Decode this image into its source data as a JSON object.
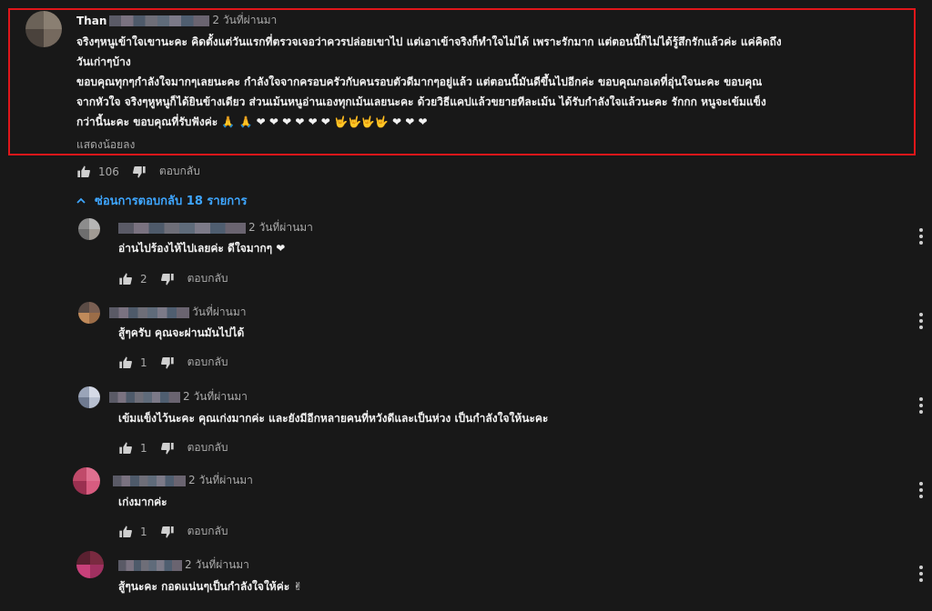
{
  "main_comment": {
    "author": "Than",
    "time": "2 วันที่ผ่านมา",
    "lines": [
      "จริงๆหนูเข้าใจเขานะคะ คิดตั้งแต่วันแรกที่ตรวจเจอว่าควรปล่อยเขาไป แต่เอาเข้าจริงก็ทำใจไม่ได้ เพราะรักมาก แต่ตอนนี้ก็ไม่ได้รู้สึกรักแล้วค่ะ แค่คิดถึง",
      "วันเก่าๆบ้าง",
      "ขอบคุณทุกๆกำลังใจมากๆเลยนะคะ กำลังใจจากครอบครัวกับคนรอบตัวดีมากๆอยู่แล้ว แต่ตอนนี้มันดีขึ้นไปอีกค่ะ ขอบคุณกอเดที่อุ่นใจนะคะ ขอบคุณ",
      "จากหัวใจ  จริงๆหูหนูก็ได้ยินข้างเดียว ส่วนเม้นหนูอ่านเองทุกเม้นเลยนะคะ ด้วยวิธีแคปแล้วขยายทีละเม้น ได้รับกำลังใจแล้วนะคะ รักกก หนูจะเข้มแข็ง",
      "กว่านี้นะคะ ขอบคุณที่รับฟังค่ะ 🙏 🙏 ❤ ❤ ❤ ❤ ❤ ❤ 🤟🤟🤟🤟 ❤ ❤ ❤"
    ],
    "show_less": "แสดงน้อยลง",
    "likes": "106",
    "reply_label": "ตอบกลับ"
  },
  "replies_toggle": {
    "label": "ซ่อนการตอบกลับ 18 รายการ"
  },
  "replies": [
    {
      "time": "2 วันที่ผ่านมา",
      "text": "อ่านไปร้องไห้ไปเลยค่ะ ดีใจมากๆ ❤",
      "likes": "2",
      "reply_label": "ตอบกลับ"
    },
    {
      "time": "วันที่ผ่านมา",
      "text": "สู้ๆครับ คุณจะผ่านมันไปได้",
      "likes": "1",
      "reply_label": "ตอบกลับ"
    },
    {
      "time": "2 วันที่ผ่านมา",
      "text": "เข้มแข็งไว้นะคะ คุณเก่งมากค่ะ และยังมีอีกหลายคนที่หวังดีและเป็นห่วง เป็นกำลังใจให้นะคะ",
      "likes": "1",
      "reply_label": "ตอบกลับ"
    },
    {
      "time": "2 วันที่ผ่านมา",
      "text": "เก่งมากค่ะ",
      "likes": "1",
      "reply_label": "ตอบกลับ"
    },
    {
      "time": "2 วันที่ผ่านมา",
      "text": "สู้ๆนะคะ กอดแน่นๆเป็นกำลังใจให้ค่ะ ✌",
      "likes": "",
      "reply_label": ""
    }
  ],
  "colors": {
    "background": "#181818",
    "highlight_border": "#e0161a",
    "link_blue": "#3ea6ff",
    "muted": "#aaaaaa"
  }
}
